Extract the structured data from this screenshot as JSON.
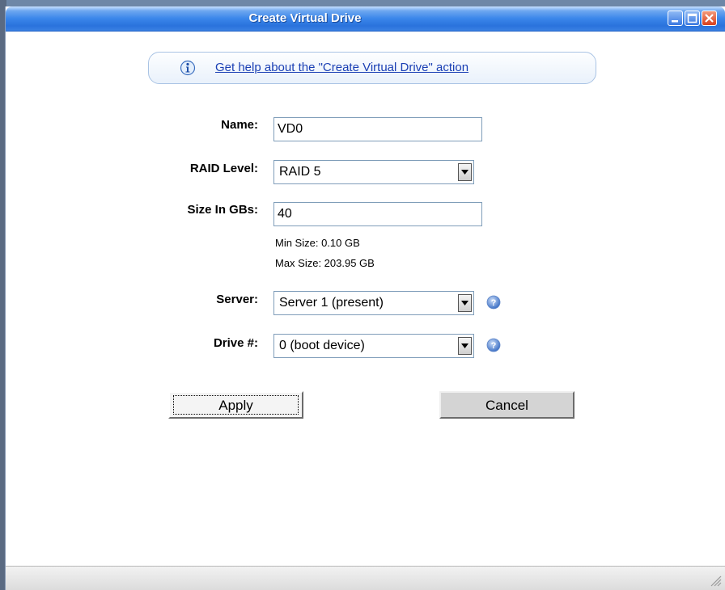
{
  "window": {
    "title": "Create Virtual Drive",
    "controls": {
      "minimize_icon": "minimize-icon",
      "maximize_icon": "maximize-icon",
      "close_icon": "close-icon"
    }
  },
  "help": {
    "icon": "info-icon",
    "link_text": "Get help about the \"Create Virtual Drive\" action"
  },
  "form": {
    "name": {
      "label": "Name:",
      "value": "VD0"
    },
    "raid_level": {
      "label": "RAID Level:",
      "selected": "RAID 5"
    },
    "size": {
      "label": "Size In GBs:",
      "value": "40",
      "min_text": "Min Size: 0.10 GB",
      "max_text": "Max Size: 203.95 GB"
    },
    "server": {
      "label": "Server:",
      "selected": "Server 1 (present)",
      "help_icon": "help-icon"
    },
    "drive": {
      "label": "Drive #:",
      "selected": "0 (boot device)",
      "help_icon": "help-icon"
    }
  },
  "buttons": {
    "apply": "Apply",
    "cancel": "Cancel"
  },
  "colors": {
    "titlebar": "#2a72dc",
    "link": "#1a3fb4",
    "helpbar_border": "#a9c3e4"
  }
}
